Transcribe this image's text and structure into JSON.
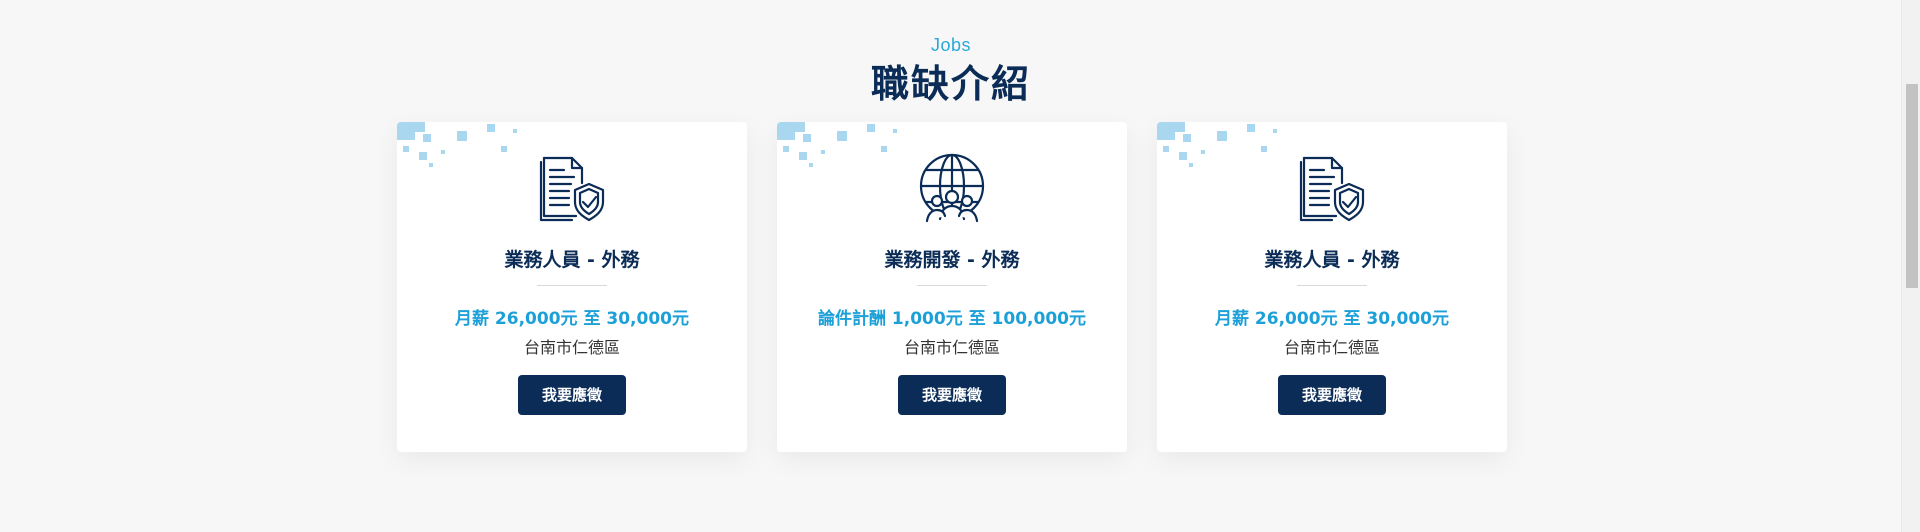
{
  "section": {
    "eyebrow": "Jobs",
    "title": "職缺介紹"
  },
  "jobs": [
    {
      "icon": "document-shield-icon",
      "title": "業務人員 - 外務",
      "salary": "月薪 26,000元 至 30,000元",
      "location": "台南市仁德區",
      "apply_label": "我要應徵"
    },
    {
      "icon": "globe-people-icon",
      "title": "業務開發 - 外務",
      "salary": "論件計酬 1,000元 至 100,000元",
      "location": "台南市仁德區",
      "apply_label": "我要應徵"
    },
    {
      "icon": "document-shield-icon",
      "title": "業務人員 - 外務",
      "salary": "月薪 26,000元 至 30,000元",
      "location": "台南市仁德區",
      "apply_label": "我要應徵"
    }
  ],
  "colors": {
    "brand_navy": "#0b2c56",
    "accent_blue": "#1ca0d8",
    "pixel_decoration": "#a9d7f0",
    "page_background": "#f7f7f7"
  }
}
